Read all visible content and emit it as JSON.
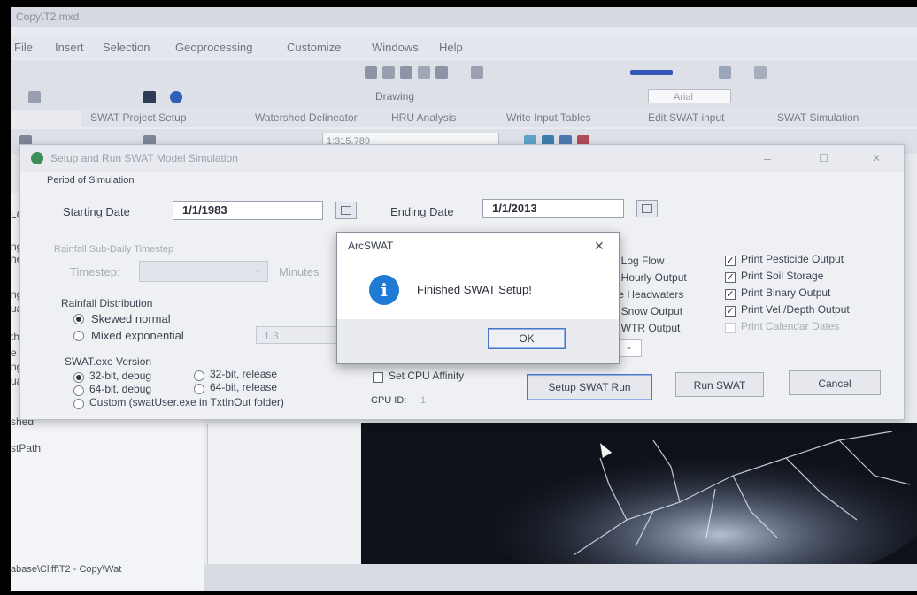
{
  "app": {
    "window_title": "Copy\\T2.mxd",
    "menus": [
      "File",
      "Insert",
      "Selection",
      "Geoprocessing",
      "Customize",
      "Windows",
      "Help"
    ],
    "drawing_label": "Drawing",
    "font_box": "Arial",
    "scale_value": "1:315,789",
    "swat_menu": [
      "SWAT Project Setup",
      "Watershed Delineator",
      "HRU Analysis",
      "Write Input Tables",
      "Edit SWAT input",
      "SWAT Simulation"
    ]
  },
  "sidepanel": {
    "fragments": [
      "LC",
      "ng",
      "he",
      "ng s",
      "ually",
      "the",
      "e",
      "ng s",
      "ually",
      "shed",
      "stPath"
    ],
    "path": "abase\\Cliff\\T2 - Copy\\Wat"
  },
  "dialog": {
    "title": "Setup and Run SWAT Model Simulation",
    "period_label": "Period of Simulation",
    "start_label": "Starting Date",
    "start_value": "1/1/1983",
    "end_label": "Ending Date",
    "end_value": "1/1/2013",
    "rainfall_timestep_label": "Rainfall Sub-Daily Timestep",
    "timestep_label": "Timestep:",
    "minutes_label": "Minutes",
    "distribution_label": "Rainfall Distribution",
    "dist_options": [
      "Skewed normal",
      "Mixed exponential"
    ],
    "mixed_exp_value": "1.3",
    "exe_label": "SWAT.exe Version",
    "exe_options": [
      "32-bit, debug",
      "32-bit, release",
      "64-bit, debug",
      "64-bit, release",
      "Custom (swatUser.exe in TxtInOut folder)"
    ],
    "cpu_affinity_label": "Set CPU Affinity",
    "cpu_id_label": "CPU ID:",
    "cpu_id_value": "1",
    "print_left": [
      "t Log Flow",
      "t Hourly Output",
      "te Headwaters",
      "t Snow Output",
      "t WTR Output"
    ],
    "print_right": [
      "Print Pesticide Output",
      "Print Soil Storage",
      "Print Binary Output",
      "Print Vel./Depth Output",
      "Print Calendar Dates"
    ],
    "buttons": {
      "setup": "Setup SWAT Run",
      "run": "Run SWAT",
      "cancel": "Cancel"
    }
  },
  "message": {
    "title": "ArcSWAT",
    "text": "Finished SWAT Setup!",
    "ok": "OK",
    "close": "✕",
    "info_glyph": "i"
  },
  "colors": {
    "info_blue": "#1f7ad6",
    "focus_blue": "#4a78c2"
  }
}
